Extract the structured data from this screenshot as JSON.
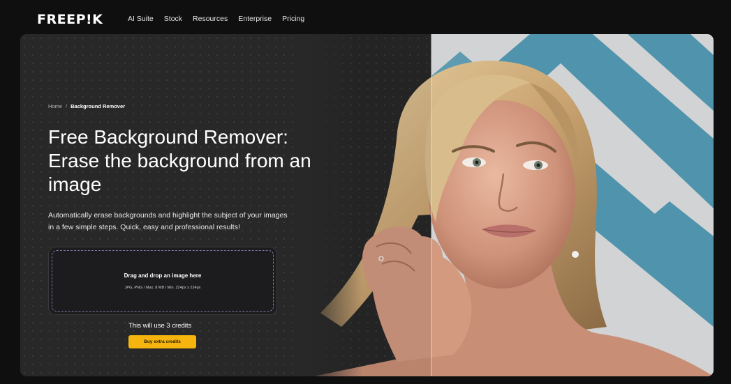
{
  "nav": {
    "logo": "FREEP!K",
    "items": [
      {
        "label": "AI Suite"
      },
      {
        "label": "Stock"
      },
      {
        "label": "Resources"
      },
      {
        "label": "Enterprise"
      },
      {
        "label": "Pricing"
      }
    ]
  },
  "hero": {
    "breadcrumb": {
      "home": "Home",
      "separator": "/",
      "current": "Background Remover"
    },
    "title": "Free Background Remover: Erase the background from an image",
    "description": "Automatically erase backgrounds and highlight the subject of your images in a few simple steps. Quick, easy and professional results!",
    "dropzone": {
      "title": "Drag and drop an image here",
      "subtitle": "JPG, PNG / Max. 8 MB / Min. 224px x 224px"
    },
    "credits_text": "This will use 3 credits",
    "buy_label": "Buy extra credits"
  },
  "colors": {
    "accent": "#f6b40e",
    "background": "#0f0f10",
    "panel": "#282828",
    "chevron_blue": "#5ca8c4"
  },
  "icons": {
    "comparison_divider": "vertical-line"
  }
}
